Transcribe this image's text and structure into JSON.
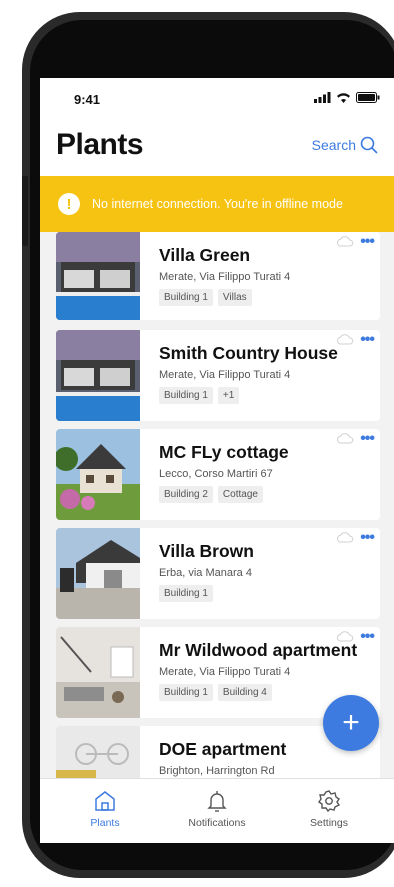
{
  "status_bar": {
    "time": "9:41"
  },
  "header": {
    "title": "Plants",
    "search_label": "Search"
  },
  "banner": {
    "icon": "!",
    "text": "No internet connection. You're in offline mode"
  },
  "plants": [
    {
      "name": "Villa Green",
      "address": "Merate, Via Filippo Turati 4",
      "tags": [
        "Building 1",
        "Villas"
      ]
    },
    {
      "name": "Smith Country House",
      "address": "Merate, Via Filippo Turati 4",
      "tags": [
        "Building 1",
        "+1"
      ]
    },
    {
      "name": "MC FLy cottage",
      "address": "Lecco, Corso Martiri 67",
      "tags": [
        "Building 2",
        "Cottage"
      ]
    },
    {
      "name": "Villa Brown",
      "address": "Erba, via Manara 4",
      "tags": [
        "Building 1"
      ]
    },
    {
      "name": "Mr Wildwood apartment",
      "address": "Merate, Via Filippo Turati 4",
      "tags": [
        "Building 1",
        "Building 4"
      ]
    },
    {
      "name": "DOE apartment",
      "address": "Brighton, Harrington Rd",
      "tags": []
    }
  ],
  "actions": {
    "more_icon": "•••",
    "fab_icon": "+"
  },
  "tabbar": {
    "plants": "Plants",
    "notifications": "Notifications",
    "settings": "Settings"
  },
  "colors": {
    "accent": "#3d7be0",
    "warning": "#f7c313"
  }
}
